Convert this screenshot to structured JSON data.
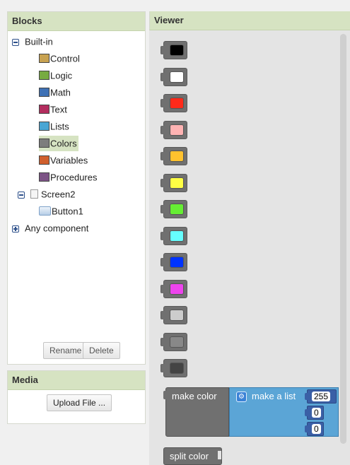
{
  "blocks_panel": {
    "title": "Blocks",
    "builtin": {
      "label": "Built-in",
      "items": [
        {
          "label": "Control",
          "color": "#c8a251"
        },
        {
          "label": "Logic",
          "color": "#77ab41"
        },
        {
          "label": "Math",
          "color": "#3f71b5"
        },
        {
          "label": "Text",
          "color": "#b32d5e"
        },
        {
          "label": "Lists",
          "color": "#49a6d4"
        },
        {
          "label": "Colors",
          "color": "#7d7d7d"
        },
        {
          "label": "Variables",
          "color": "#d05f2d"
        },
        {
          "label": "Procedures",
          "color": "#7c5385"
        }
      ]
    },
    "screen": {
      "label": "Screen2",
      "children": [
        {
          "label": "Button1"
        }
      ]
    },
    "any_component": {
      "label": "Any component"
    },
    "rename_label": "Rename",
    "delete_label": "Delete"
  },
  "media_panel": {
    "title": "Media",
    "upload_label": "Upload File ..."
  },
  "viewer": {
    "title": "Viewer",
    "color_swatches": [
      "#000000",
      "#ffffff",
      "#ff2a1a",
      "#ffb3b3",
      "#ffc22e",
      "#ffff44",
      "#66ee33",
      "#66ffff",
      "#0033ff",
      "#ee44ee",
      "#cccccc",
      "#888888",
      "#444444"
    ],
    "make_color": {
      "label": "make color",
      "make_list_label": "make a list",
      "gear_icon": "gear-icon",
      "values": [
        "255",
        "0",
        "0"
      ]
    },
    "split_color_label": "split color"
  }
}
